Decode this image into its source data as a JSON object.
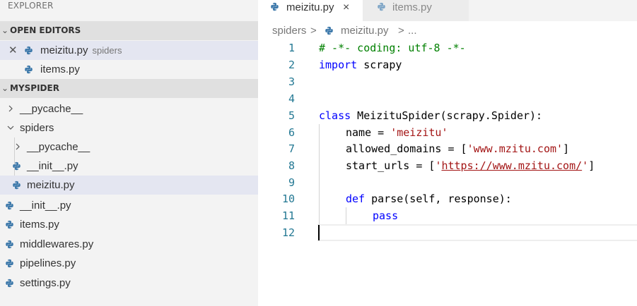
{
  "explorer": {
    "title": "EXPLORER",
    "open_editors": {
      "header": "OPEN EDITORS",
      "items": [
        {
          "label": "meizitu.py",
          "description": "spiders"
        },
        {
          "label": "items.py"
        }
      ]
    },
    "project": {
      "header": "MYSPIDER",
      "items": [
        {
          "label": "__pycache__"
        },
        {
          "label": "spiders"
        },
        {
          "label": "__pycache__"
        },
        {
          "label": "__init__.py"
        },
        {
          "label": "meizitu.py"
        },
        {
          "label": "__init__.py"
        },
        {
          "label": "items.py"
        },
        {
          "label": "middlewares.py"
        },
        {
          "label": "pipelines.py"
        },
        {
          "label": "settings.py"
        }
      ]
    }
  },
  "tabs": [
    {
      "label": "meizitu.py",
      "close": "×"
    },
    {
      "label": "items.py"
    }
  ],
  "breadcrumb": {
    "folder": "spiders",
    "sep": ">",
    "file": "meizitu.py",
    "more": "..."
  },
  "editor": {
    "line_numbers": [
      "1",
      "2",
      "3",
      "4",
      "5",
      "6",
      "7",
      "8",
      "9",
      "10",
      "11",
      "12"
    ],
    "lines": {
      "l1": "# -*- coding: utf-8 -*-",
      "l2_kw": "import",
      "l2_rest": " scrapy",
      "l5_kw": "class",
      "l5_rest": " MeizituSpider(scrapy.Spider):",
      "l6_a": "name = ",
      "l6_str": "'meizitu'",
      "l7_a": "allowed_domains = [",
      "l7_str": "'www.mzitu.com'",
      "l7_b": "]",
      "l8_a": "start_urls = [",
      "l8_q1": "'",
      "l8_url": "https://www.mzitu.com/",
      "l8_q2": "'",
      "l8_b": "]",
      "l10_kw": "def",
      "l10_rest": " parse(self, response):",
      "l11_kw": "pass"
    }
  },
  "colors": {
    "python_icon": "#3c78aa",
    "line_number": "#237893",
    "keyword": "#0000ff",
    "string": "#a31515",
    "comment": "#008000"
  }
}
